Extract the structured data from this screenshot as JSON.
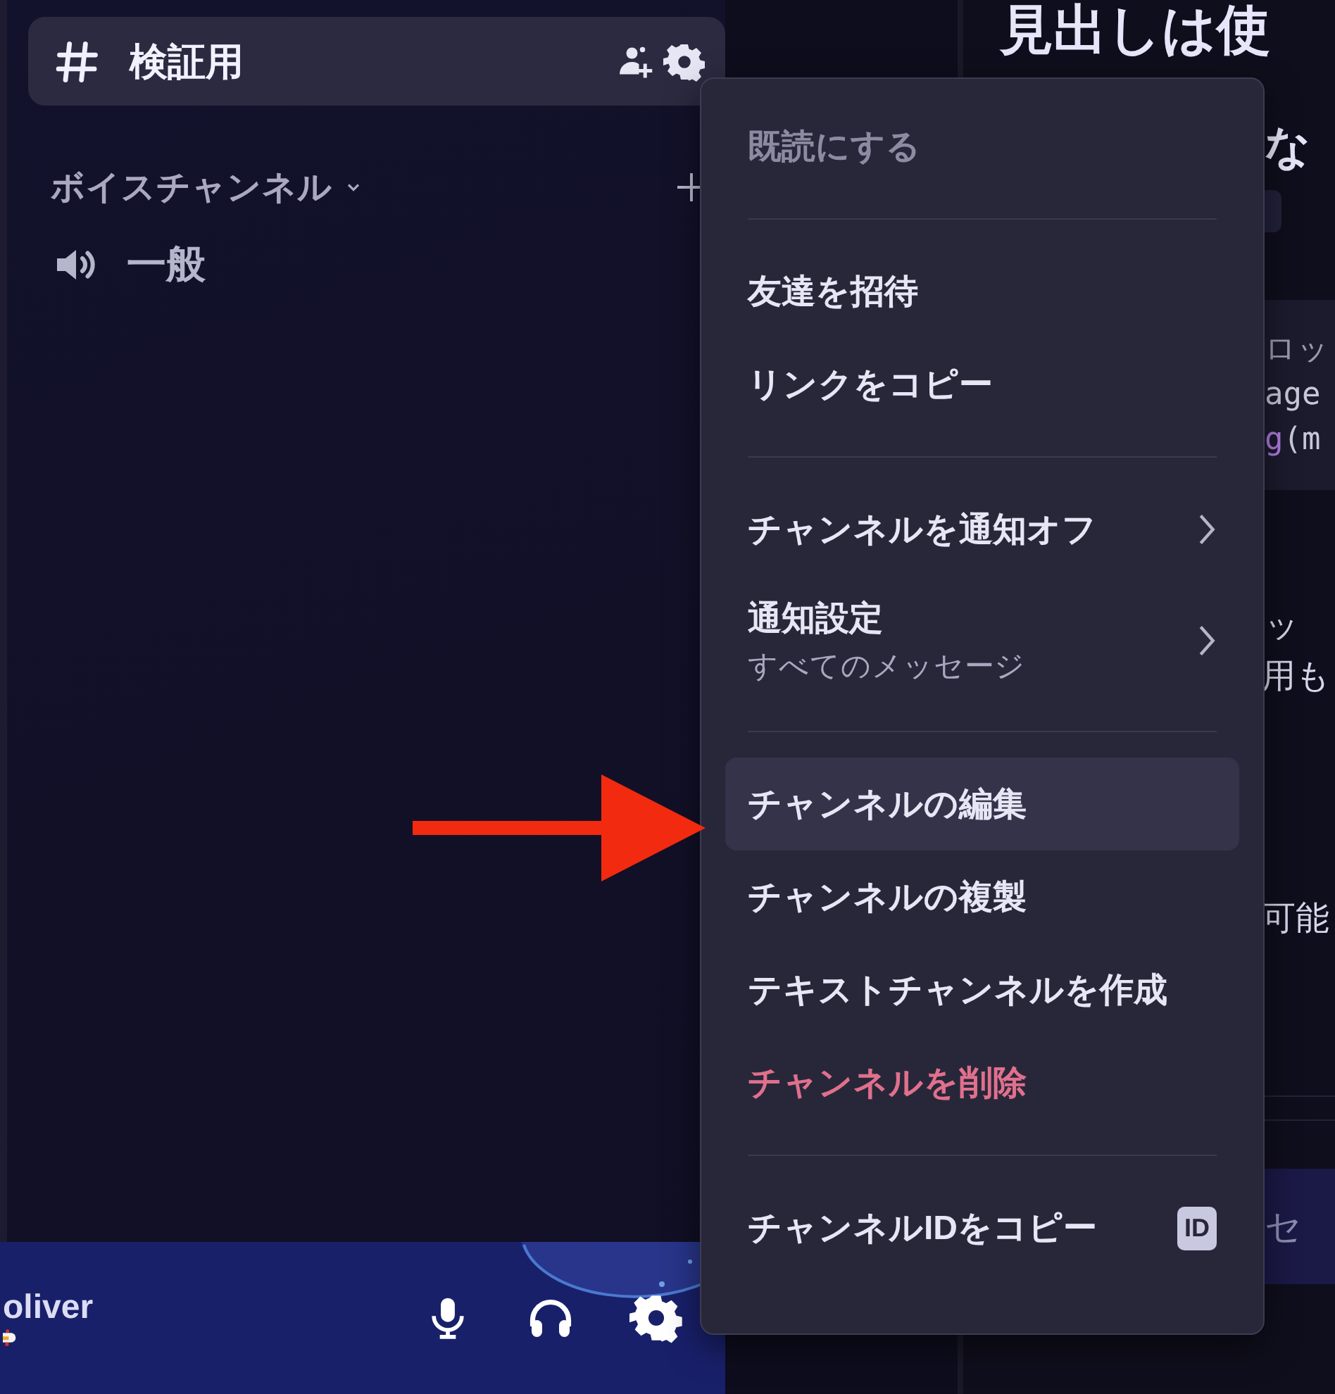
{
  "sidebar": {
    "channel_header": {
      "name": "検証用",
      "selected": true
    },
    "category": {
      "name": "ボイスチャンネル",
      "expanded": true
    },
    "voice_channels": [
      {
        "name": "一般"
      }
    ]
  },
  "user_panel": {
    "username": "oliver"
  },
  "main": {
    "heading": "見出しは使",
    "subheading": "な",
    "code_lines": [
      {
        "segments": [
          {
            "text": "ロッ",
            "kind": "comment"
          }
        ]
      },
      {
        "segments": [
          {
            "text": "age",
            "kind": "plain"
          }
        ]
      },
      {
        "segments": [
          {
            "text": "g",
            "kind": "function"
          },
          {
            "text": "(m",
            "kind": "plain"
          }
        ]
      }
    ],
    "text_lines": [
      "ッ",
      "用も",
      "可能"
    ],
    "input": {
      "placeholder": "セ"
    }
  },
  "context_menu": {
    "items": [
      {
        "kind": "item",
        "label": "既読にする",
        "disabled": true,
        "danger": false,
        "selected": false
      },
      {
        "kind": "separator"
      },
      {
        "kind": "item",
        "label": "友達を招待",
        "disabled": false,
        "danger": false,
        "selected": false
      },
      {
        "kind": "item",
        "label": "リンクをコピー",
        "disabled": false,
        "danger": false,
        "selected": false
      },
      {
        "kind": "separator"
      },
      {
        "kind": "submenu",
        "label": "チャンネルを通知オフ",
        "disabled": false,
        "danger": false,
        "selected": false
      },
      {
        "kind": "submenu",
        "label": "通知設定",
        "sublabel": "すべてのメッセージ",
        "disabled": false,
        "danger": false,
        "selected": false
      },
      {
        "kind": "separator"
      },
      {
        "kind": "item",
        "label": "チャンネルの編集",
        "disabled": false,
        "danger": false,
        "selected": true
      },
      {
        "kind": "item",
        "label": "チャンネルの複製",
        "disabled": false,
        "danger": false,
        "selected": false
      },
      {
        "kind": "item",
        "label": "テキストチャンネルを作成",
        "disabled": false,
        "danger": false,
        "selected": false
      },
      {
        "kind": "item",
        "label": "チャンネルを削除",
        "disabled": false,
        "danger": true,
        "selected": false
      },
      {
        "kind": "separator"
      },
      {
        "kind": "item",
        "label": "チャンネルIDをコピー",
        "badge": "ID",
        "disabled": false,
        "danger": false,
        "selected": false
      }
    ]
  },
  "annotation": {
    "kind": "arrow"
  }
}
